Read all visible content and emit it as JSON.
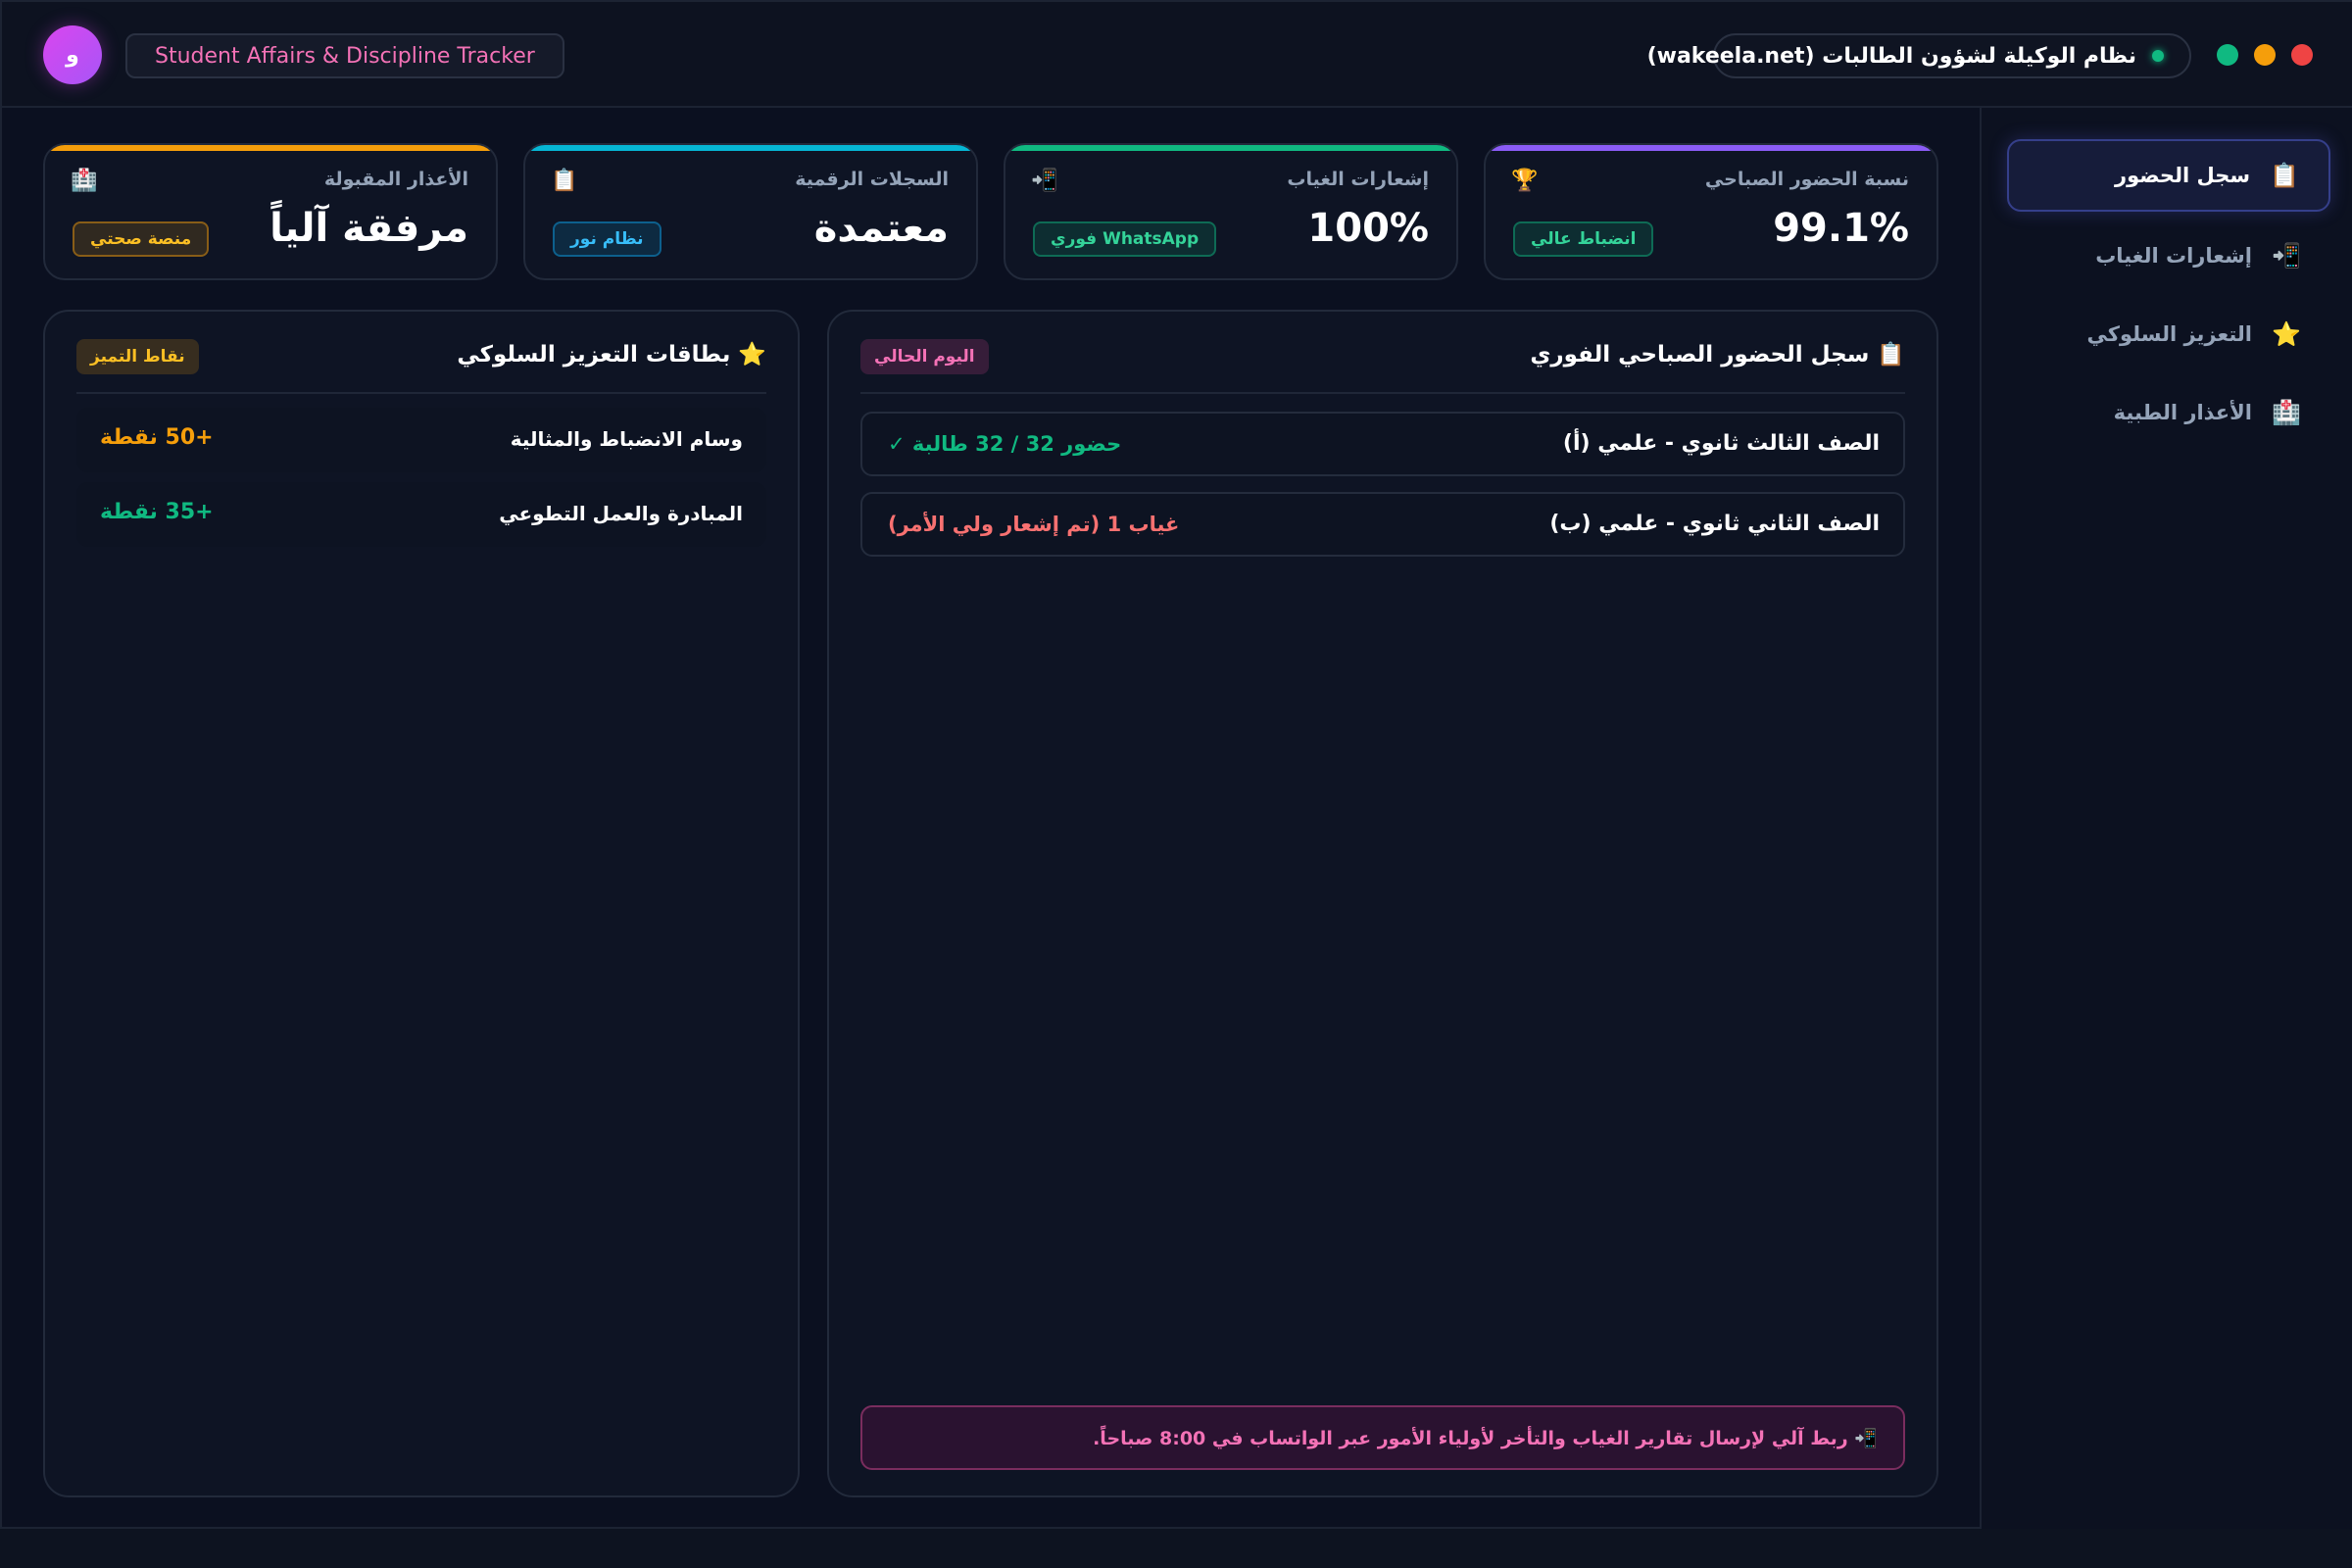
{
  "header": {
    "logo_letter": "و",
    "app_tag": "Student Affairs & Discipline Tracker",
    "system_name": "نظام الوكيلة لشؤون الطالبات (wakeela.net)"
  },
  "sidebar": {
    "items": [
      {
        "label": "سجل الحضور",
        "icon": "📋",
        "icon_name": "clipboard-icon",
        "active": true
      },
      {
        "label": "إشعارات الغياب",
        "icon": "📲",
        "icon_name": "phone-notify-icon",
        "active": false
      },
      {
        "label": "التعزيز السلوكي",
        "icon": "⭐",
        "icon_name": "star-icon",
        "active": false
      },
      {
        "label": "الأعذار الطبية",
        "icon": "🏥",
        "icon_name": "hospital-icon",
        "active": false
      }
    ]
  },
  "stats": [
    {
      "label": "نسبة الحضور الصباحي",
      "value": "99.1%",
      "badge": "انضباط عالي",
      "icon": "🏆",
      "icon_name": "trophy-icon",
      "accent": "#8b5cf6",
      "badge_color": "#10b981"
    },
    {
      "label": "إشعارات الغياب",
      "value": "100%",
      "badge": "WhatsApp فوري",
      "icon": "📲",
      "icon_name": "phone-notify-icon",
      "accent": "#10b981",
      "badge_color": "#10b981"
    },
    {
      "label": "السجلات الرقمية",
      "value": "معتمدة",
      "badge": "نظام نور",
      "icon": "📋",
      "icon_name": "clipboard-icon",
      "accent": "#06b6d4",
      "badge_color": "#0ea5e9"
    },
    {
      "label": "الأعذار المقبولة",
      "value": "مرفقة آلياً",
      "badge": "منصة صحتي",
      "icon": "🏥",
      "icon_name": "hospital-icon",
      "accent": "#f59e0b",
      "badge_color": "#f59e0b"
    }
  ],
  "attendance": {
    "title": "📋 سجل الحضور الصباحي الفوري",
    "tag": "اليوم الحالي",
    "rows": [
      {
        "class_name": "الصف الثالث ثانوي - علمي (أ)",
        "status": "حضور 32 / 32 طالبة ✓",
        "status_color": "#10b981"
      },
      {
        "class_name": "الصف الثاني ثانوي - علمي (ب)",
        "status": "غياب 1 (تم إشعار ولي الأمر)",
        "status_color": "#f87171"
      }
    ],
    "alert": "📲 ربط آلي لإرسال تقارير الغياب والتأخر لأولياء الأمور عبر الواتساب في 8:00 صباحاً."
  },
  "rewards": {
    "title": "⭐ بطاقات التعزيز السلوكي",
    "tag": "نقاط التميز",
    "items": [
      {
        "name": "وسام الانضباط والمثالية",
        "points": "+50 نقطة",
        "color": "#f59e0b"
      },
      {
        "name": "المبادرة والعمل التطوعي",
        "points": "+35 نقطة",
        "color": "#10b981"
      }
    ]
  }
}
